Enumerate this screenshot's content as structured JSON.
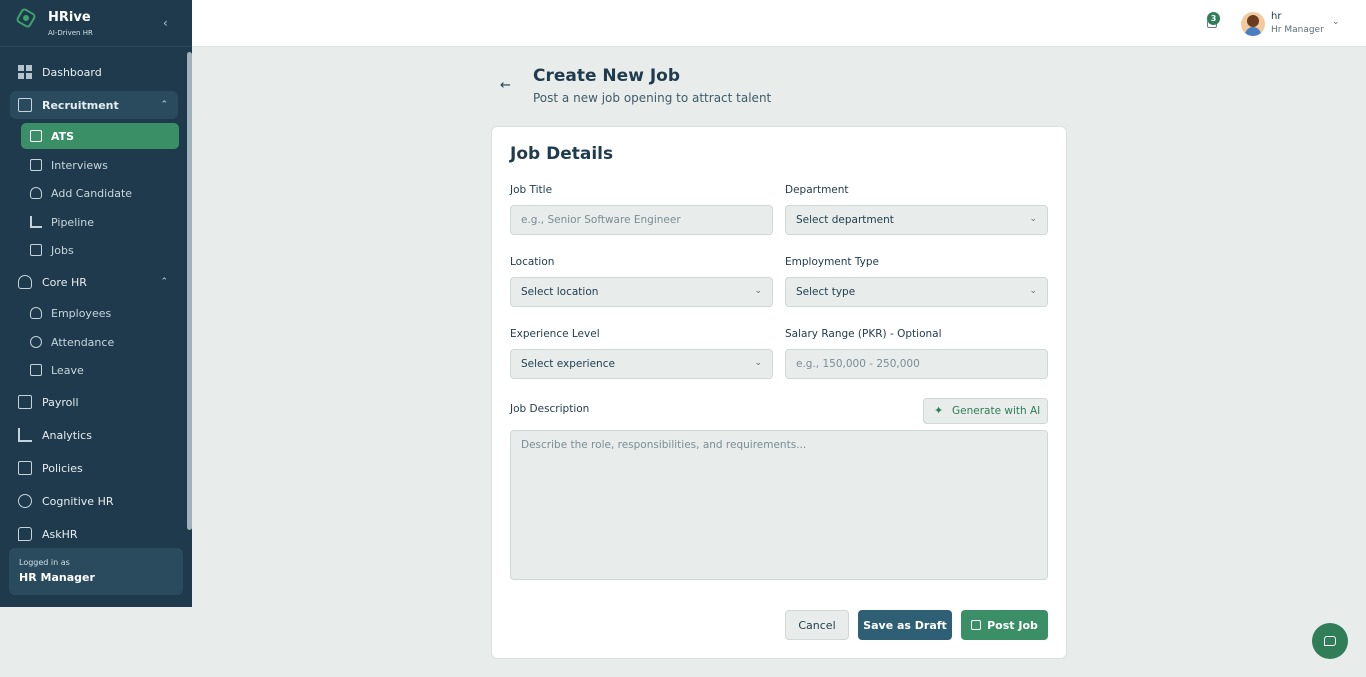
{
  "brand": {
    "name": "HRive",
    "tagline": "AI-Driven HR"
  },
  "sidebar": {
    "items": [
      {
        "label": "Dashboard",
        "icon": "grid-icon"
      },
      {
        "label": "Recruitment",
        "icon": "briefcase-icon",
        "expanded": true,
        "children": [
          {
            "label": "ATS",
            "icon": "briefcase-icon",
            "active": true
          },
          {
            "label": "Interviews",
            "icon": "video-icon"
          },
          {
            "label": "Add Candidate",
            "icon": "user-plus-icon"
          },
          {
            "label": "Pipeline",
            "icon": "pipeline-icon"
          },
          {
            "label": "Jobs",
            "icon": "file-icon"
          }
        ]
      },
      {
        "label": "Core HR",
        "icon": "users-icon",
        "expanded": true,
        "children": [
          {
            "label": "Employees",
            "icon": "users-icon"
          },
          {
            "label": "Attendance",
            "icon": "clock-icon"
          },
          {
            "label": "Leave",
            "icon": "calendar-icon"
          }
        ]
      },
      {
        "label": "Payroll",
        "icon": "wallet-icon"
      },
      {
        "label": "Analytics",
        "icon": "bar-chart-icon"
      },
      {
        "label": "Policies",
        "icon": "file-icon"
      },
      {
        "label": "Cognitive HR",
        "icon": "globe-icon"
      },
      {
        "label": "AskHR",
        "icon": "message-icon"
      }
    ],
    "logged_in_label": "Logged in as",
    "logged_in_role": "HR Manager"
  },
  "topbar": {
    "notification_count": "3",
    "user_name": "hr",
    "user_role": "Hr Manager"
  },
  "header": {
    "title": "Create New Job",
    "subtitle": "Post a new job opening to attract talent"
  },
  "form": {
    "section_title": "Job Details",
    "job_title": {
      "label": "Job Title",
      "placeholder": "e.g., Senior Software Engineer"
    },
    "department": {
      "label": "Department",
      "value": "Select department"
    },
    "location": {
      "label": "Location",
      "value": "Select location"
    },
    "employment_type": {
      "label": "Employment Type",
      "value": "Select type"
    },
    "experience_level": {
      "label": "Experience Level",
      "value": "Select experience"
    },
    "salary_range": {
      "label": "Salary Range (PKR) - Optional",
      "placeholder": "e.g., 150,000 - 250,000"
    },
    "job_description": {
      "label": "Job Description",
      "placeholder": "Describe the role, responsibilities, and requirements..."
    },
    "generate_ai_label": "Generate with AI",
    "cancel_label": "Cancel",
    "draft_label": "Save as Draft",
    "post_label": "Post Job"
  },
  "colors": {
    "sidebar_bg": "#1e3a4c",
    "accent_green": "#3a8f67",
    "draft_button": "#2f5f74",
    "page_bg": "#e8edeb"
  }
}
